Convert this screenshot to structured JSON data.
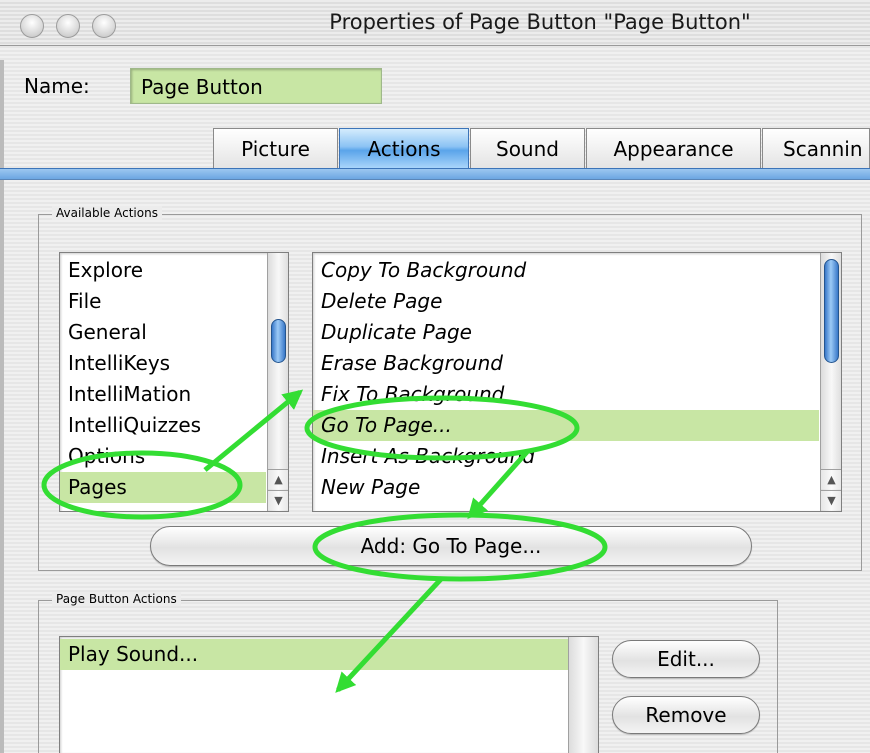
{
  "window": {
    "title": "Properties of Page Button \"Page Button\""
  },
  "name": {
    "label": "Name:",
    "value": "Page Button"
  },
  "tabs": [
    {
      "label": "Picture",
      "active": false
    },
    {
      "label": "Actions",
      "active": true
    },
    {
      "label": "Sound",
      "active": false
    },
    {
      "label": "Appearance",
      "active": false
    },
    {
      "label": "Scannin",
      "active": false
    }
  ],
  "available_actions": {
    "title": "Available Actions",
    "categories": [
      "Explore",
      "File",
      "General",
      "IntelliKeys",
      "IntelliMation",
      "IntelliQuizzes",
      "Options",
      "Pages"
    ],
    "selected_category": "Pages",
    "actions": [
      "Copy To Background",
      "Delete Page",
      "Duplicate Page",
      "Erase Background",
      "Fix To Background",
      "Go To Page...",
      "Insert As Background",
      "New Page"
    ],
    "selected_action": "Go To Page...",
    "add_button": "Add:  Go To Page..."
  },
  "page_button_actions": {
    "title": "Page Button Actions",
    "items": [
      "Play Sound..."
    ],
    "edit_button": "Edit...",
    "remove_button": "Remove"
  },
  "colors": {
    "selection": "#c8e6a4",
    "annotation": "#33dd33",
    "tab_active": "#5aa4ea"
  }
}
